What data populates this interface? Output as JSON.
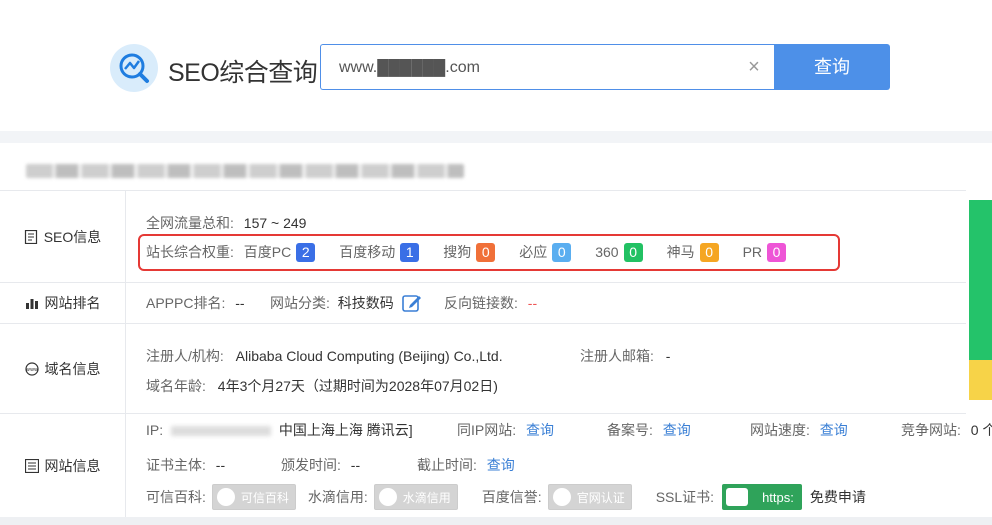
{
  "brand": "SEO综合查询",
  "search": {
    "value": "www.██████.com",
    "button": "查询"
  },
  "seo": {
    "label": "SEO信息",
    "traffic_label": "全网流量总和:",
    "traffic_value": "157 ~ 249",
    "weight_label": "站长综合权重:",
    "weights": [
      {
        "name": "百度PC",
        "value": "2",
        "color": "#3a6fe6"
      },
      {
        "name": "百度移动",
        "value": "1",
        "color": "#3a6fe6"
      },
      {
        "name": "搜狗",
        "value": "0",
        "color": "#f07039"
      },
      {
        "name": "必应",
        "value": "0",
        "color": "#5aaef0"
      },
      {
        "name": "360",
        "value": "0",
        "color": "#22c163"
      },
      {
        "name": "神马",
        "value": "0",
        "color": "#f5a623"
      },
      {
        "name": "PR",
        "value": "0",
        "color": "#ee55d6"
      }
    ]
  },
  "rank": {
    "label": "网站排名",
    "apppc_label": "APPPC排名:",
    "apppc_value": "--",
    "category_label": "网站分类:",
    "category_value": "科技数码",
    "backlinks_label": "反向链接数:",
    "backlinks_value": "--"
  },
  "domain": {
    "label": "域名信息",
    "registrant_label": "注册人/机构:",
    "registrant_value": "Alibaba Cloud Computing (Beijing) Co.,Ltd.",
    "email_label": "注册人邮箱:",
    "email_value": "-",
    "age_label": "域名年龄:",
    "age_value": "4年3个月27天（过期时间为2028年07月02日)"
  },
  "site": {
    "label": "网站信息",
    "ip_label": "IP:",
    "ip_location": "中国上海上海 腾讯云]",
    "same_ip_label": "同IP网站:",
    "same_ip_link": "查询",
    "icp_label": "备案号:",
    "icp_link": "查询",
    "speed_label": "网站速度:",
    "speed_link": "查询",
    "compete_label": "竞争网站:",
    "compete_value": "0 个",
    "cert_label": "证书主体:",
    "cert_value": "--",
    "issue_label": "颁发时间:",
    "issue_value": "--",
    "expire_label": "截止时间:",
    "expire_link": "查询",
    "kexin_label": "可信百科:",
    "kexin_chip": "可信百科",
    "shuidi_label": "水滴信用:",
    "shuidi_chip": "水滴信用",
    "baidu_label": "百度信誉:",
    "baidu_chip": "官网认证",
    "ssl_label": "SSL证书:",
    "ssl_chip": "https:",
    "ssl_free": "免费申请"
  }
}
